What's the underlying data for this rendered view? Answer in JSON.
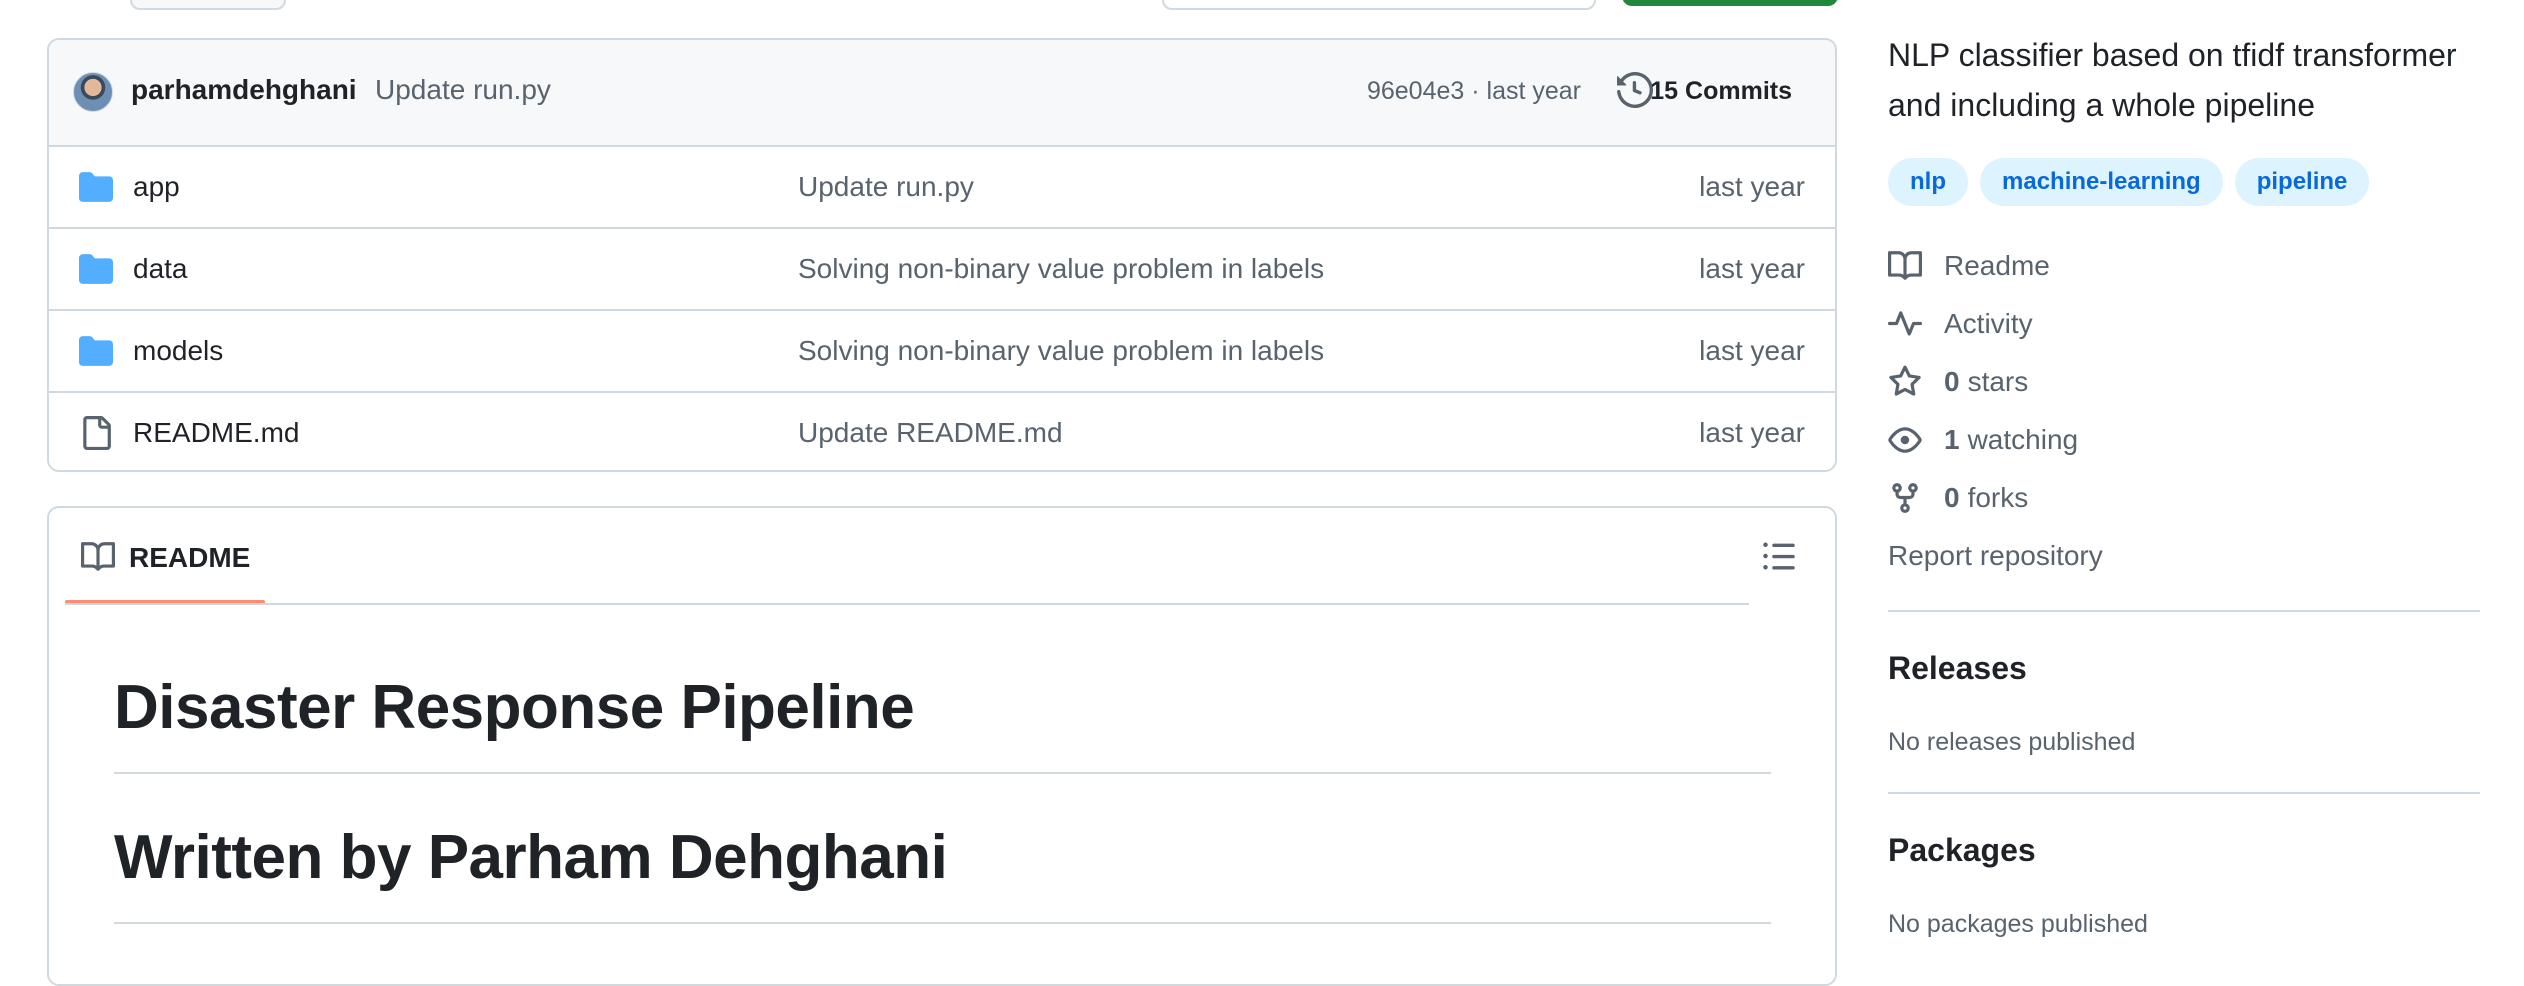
{
  "commit_bar": {
    "author": "parhamdehghani",
    "message": "Update run.py",
    "meta": "96e04e3 · last year",
    "commits_count": "15",
    "commits_label": "Commits"
  },
  "files": [
    {
      "icon": "folder-icon",
      "name": "app",
      "message": "Update run.py",
      "time": "last year"
    },
    {
      "icon": "folder-icon",
      "name": "data",
      "message": "Solving non-binary value problem in labels",
      "time": "last year"
    },
    {
      "icon": "folder-icon",
      "name": "models",
      "message": "Solving non-binary value problem in labels",
      "time": "last year"
    },
    {
      "icon": "file-icon",
      "name": "README.md",
      "message": "Update README.md",
      "time": "last year"
    }
  ],
  "readme": {
    "tab_label": "README",
    "headings": [
      "Disaster Response Pipeline",
      "Written by Parham Dehghani"
    ]
  },
  "sidebar": {
    "description": "NLP classifier based on tfidf transformer and including a whole pipeline",
    "topics": [
      "nlp",
      "machine-learning",
      "pipeline"
    ],
    "readme_label": "Readme",
    "activity_label": "Activity",
    "stars_count": "0",
    "stars_label": "stars",
    "watching_count": "1",
    "watching_label": "watching",
    "forks_count": "0",
    "forks_label": "forks",
    "report_label": "Report repository",
    "releases_title": "Releases",
    "releases_note": "No releases published",
    "packages_title": "Packages",
    "packages_note": "No packages published"
  },
  "colors": {
    "accent_link": "#0969da",
    "topic_bg": "#ddf4ff",
    "folder": "#54aeff",
    "tab_underline": "#fd8c73",
    "primary_button": "#1f883d"
  }
}
